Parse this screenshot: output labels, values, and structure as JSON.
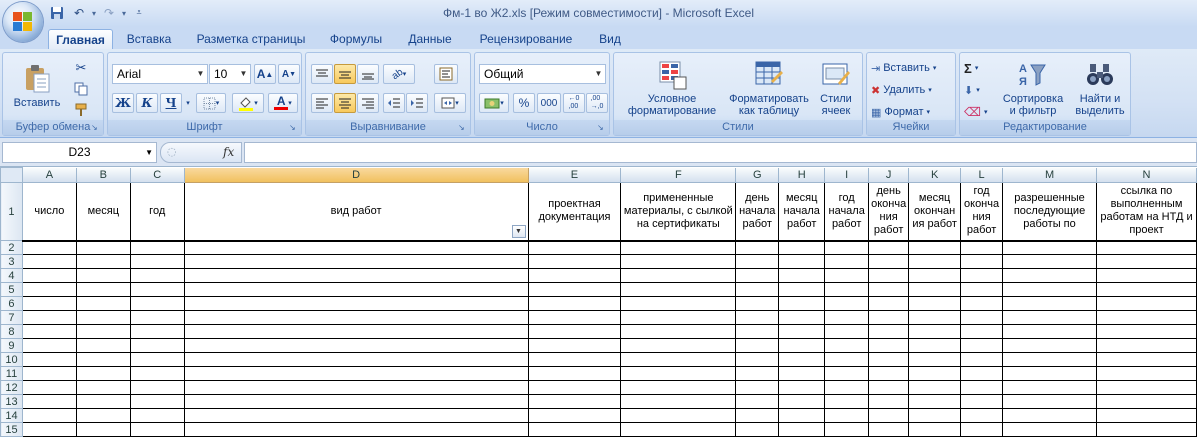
{
  "window": {
    "title": "Фм-1 во Ж2.xls  [Режим совместимости] - Microsoft Excel"
  },
  "tabs": [
    "Главная",
    "Вставка",
    "Разметка страницы",
    "Формулы",
    "Данные",
    "Рецензирование",
    "Вид"
  ],
  "active_tab": "Главная",
  "ribbon": {
    "clipboard": {
      "label": "Буфер обмена",
      "paste": "Вставить"
    },
    "font": {
      "label": "Шрифт",
      "name": "Arial",
      "size": "10",
      "bold": "Ж",
      "italic": "К",
      "underline": "Ч"
    },
    "alignment": {
      "label": "Выравнивание"
    },
    "number": {
      "label": "Число",
      "format": "Общий"
    },
    "styles": {
      "label": "Стили",
      "conditional_line1": "Условное",
      "conditional_line2": "форматирование",
      "as_table_line1": "Форматировать",
      "as_table_line2": "как таблицу",
      "cell_styles_line1": "Стили",
      "cell_styles_line2": "ячеек"
    },
    "cells": {
      "label": "Ячейки",
      "insert": "Вставить",
      "delete": "Удалить",
      "format": "Формат"
    },
    "editing": {
      "label": "Редактирование",
      "sort_line1": "Сортировка",
      "sort_line2": "и фильтр",
      "find_line1": "Найти и",
      "find_line2": "выделить"
    }
  },
  "formula_bar": {
    "name_box": "D23",
    "fx": "fx",
    "formula": ""
  },
  "columns": [
    "A",
    "B",
    "C",
    "D",
    "E",
    "F",
    "G",
    "H",
    "I",
    "J",
    "K",
    "L",
    "M",
    "N"
  ],
  "selected_column": "D",
  "header_row": {
    "row_number": "1",
    "cells": [
      "число",
      "месяц",
      "год",
      "вид работ",
      "проектная документация",
      "примененные материалы, с сылкой на сертификаты",
      "день начала работ",
      "месяц начала работ",
      "год начала работ",
      "день оконча ния работ",
      "месяц окончан ия работ",
      "год оконча ния работ",
      "разрешенные последующие работы по",
      "ссылка по выполненным работам на НТД и проект"
    ]
  },
  "row_numbers": [
    "2",
    "3",
    "4",
    "5",
    "6",
    "7",
    "8",
    "9",
    "10",
    "11",
    "12",
    "13",
    "14",
    "15"
  ],
  "colors": {
    "accent": "#15428b",
    "selected_header": "#f5c96b"
  }
}
